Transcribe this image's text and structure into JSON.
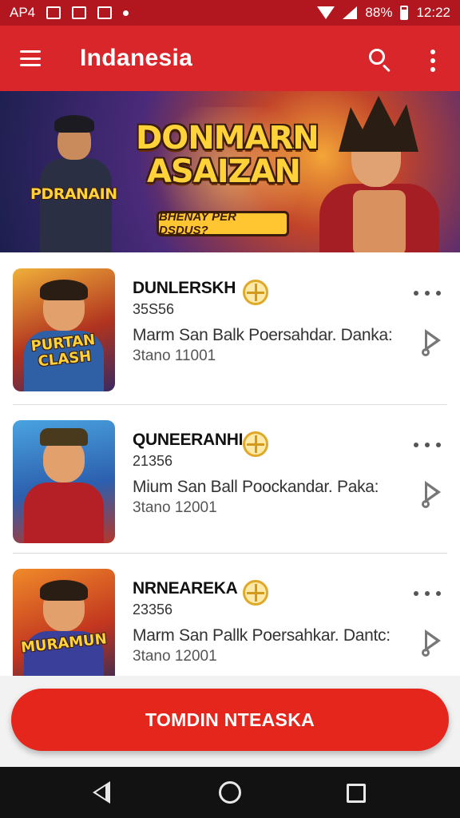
{
  "status_bar": {
    "left_text": "AP4",
    "battery": "88%",
    "time": "12:22"
  },
  "app_bar": {
    "title": "Indanesia"
  },
  "banner": {
    "title_line1": "DONMARN",
    "title_line2": "ASAIZAN",
    "subtitle": "BHENAY PER DSDUS?",
    "side_label": "PDRANAIN"
  },
  "list": {
    "items": [
      {
        "title": "DUNLERSKH",
        "code": "35S56",
        "description": "Marm San Balk Poersahdar. Danka:",
        "meta": "3tano 11001",
        "thumb_label": "PURTAN CLASH",
        "thumb_bg": "#3b6fb0"
      },
      {
        "title": "QUNEERANHI",
        "code": "21356",
        "description": "Mium San Ball Poockandar. Paka:",
        "meta": "3tano 12001",
        "thumb_label": "",
        "thumb_bg": "#2c7fc4"
      },
      {
        "title": "NRNEAREKA",
        "code": "23356",
        "description": "Marm San Pallk Poersahkar. Dantc:",
        "meta": "3tano 12001",
        "thumb_label": "MURAMUN",
        "thumb_bg": "#d0572a"
      }
    ]
  },
  "cta": {
    "label": "TOMDIN NTEASKA"
  },
  "colors": {
    "app_bar": "#d8262b",
    "status_bar": "#b2161f",
    "cta": "#e4261c",
    "badge_gold": "#e0a92a"
  },
  "icons": {
    "menu": "hamburger-icon",
    "search": "search-icon",
    "overflow": "more-vert-icon",
    "item_more": "more-horiz-icon",
    "item_play": "play-icon",
    "badge": "gold-coin-icon"
  }
}
